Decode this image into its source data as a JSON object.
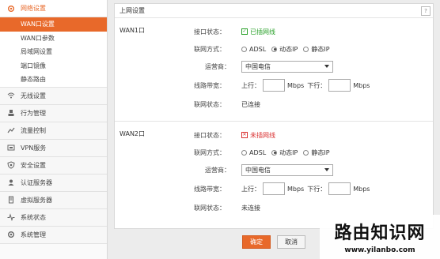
{
  "sidebar": {
    "network": {
      "label": "网络设置",
      "icon": "gear-icon",
      "items": [
        {
          "label": "WAN口设置",
          "active": true
        },
        {
          "label": "WAN口参数"
        },
        {
          "label": "局域网设置"
        },
        {
          "label": "端口镜像"
        },
        {
          "label": "静态路由"
        }
      ]
    },
    "groups": [
      {
        "label": "无线设置",
        "icon": "wifi-icon"
      },
      {
        "label": "行为管理",
        "icon": "user-icon"
      },
      {
        "label": "流量控制",
        "icon": "traffic-icon"
      },
      {
        "label": "VPN服务",
        "icon": "vpn-icon"
      },
      {
        "label": "安全设置",
        "icon": "shield-icon"
      },
      {
        "label": "认证服务器",
        "icon": "auth-icon"
      },
      {
        "label": "虚拟服务器",
        "icon": "server-icon"
      },
      {
        "label": "系统状态",
        "icon": "pulse-icon"
      },
      {
        "label": "系统管理",
        "icon": "settings-icon"
      }
    ]
  },
  "main": {
    "title": "上网设置",
    "help": "?"
  },
  "labels": {
    "port_status": "接口状态：",
    "conn_mode": "联网方式：",
    "isp": "运营商：",
    "bandwidth": "线路带宽：",
    "net_status": "联网状态：",
    "up": "上行：",
    "down": "下行：",
    "unit": "Mbps"
  },
  "wan1": {
    "title": "WAN1口",
    "port_status": "已插网线",
    "modes": [
      "ADSL",
      "动态IP",
      "静态IP"
    ],
    "selected_mode": "动态IP",
    "isp": "中国电信",
    "up_value": "",
    "down_value": "",
    "net_status": "已连接"
  },
  "wan2": {
    "title": "WAN2口",
    "port_status": "未插网线",
    "modes": [
      "ADSL",
      "动态IP",
      "静态IP"
    ],
    "selected_mode": "动态IP",
    "isp": "中国电信",
    "up_value": "",
    "down_value": "",
    "net_status": "未连接"
  },
  "buttons": {
    "ok": "确定",
    "cancel": "取消"
  },
  "watermark": {
    "title": "路由知识网",
    "url": "www.yilanbo.com"
  },
  "colors": {
    "accent": "#e8692a",
    "ok": "#2aa12a",
    "error": "#d93030"
  }
}
